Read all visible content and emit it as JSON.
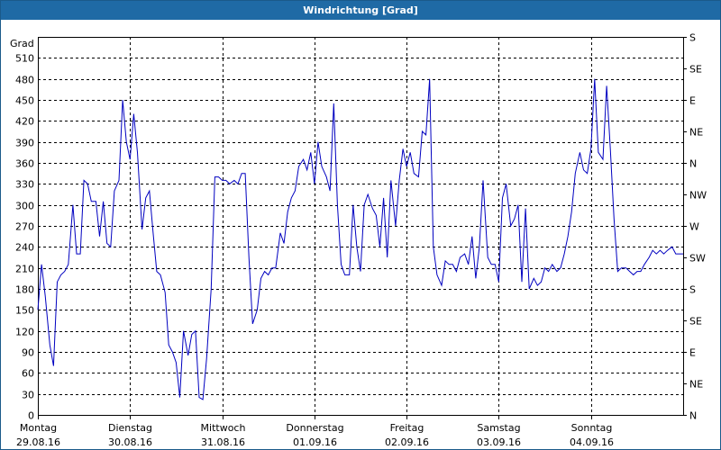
{
  "window": {
    "title": "Windrichtung [Grad]"
  },
  "chart_data": {
    "type": "line",
    "title": "Windrichtung [Grad]",
    "ylabel": "Grad",
    "ylim": [
      0,
      540
    ],
    "xlim": [
      0,
      7
    ],
    "grid": true,
    "y_ticks": [
      0,
      30,
      60,
      90,
      120,
      150,
      180,
      210,
      240,
      270,
      300,
      330,
      360,
      390,
      420,
      450,
      480,
      510
    ],
    "y2_labels": [
      {
        "value": 0,
        "label": "N"
      },
      {
        "value": 45,
        "label": "NE"
      },
      {
        "value": 90,
        "label": "E"
      },
      {
        "value": 135,
        "label": "SE"
      },
      {
        "value": 180,
        "label": "S"
      },
      {
        "value": 225,
        "label": "SW"
      },
      {
        "value": 270,
        "label": "W"
      },
      {
        "value": 315,
        "label": "NW"
      },
      {
        "value": 360,
        "label": "N"
      },
      {
        "value": 405,
        "label": "NE"
      },
      {
        "value": 450,
        "label": "E"
      },
      {
        "value": 495,
        "label": "SE"
      },
      {
        "value": 540,
        "label": "S"
      }
    ],
    "x_ticks": [
      {
        "x": 0,
        "day": "Montag",
        "date": "29.08.16"
      },
      {
        "x": 1,
        "day": "Dienstag",
        "date": "30.08.16"
      },
      {
        "x": 2,
        "day": "Mittwoch",
        "date": "31.08.16"
      },
      {
        "x": 3,
        "day": "Donnerstag",
        "date": "01.09.16"
      },
      {
        "x": 4,
        "day": "Freitag",
        "date": "02.09.16"
      },
      {
        "x": 5,
        "day": "Samstag",
        "date": "03.09.16"
      },
      {
        "x": 6,
        "day": "Sonntag",
        "date": "04.09.16"
      }
    ],
    "series": [
      {
        "color": "#0000c0",
        "points": [
          [
            0.0,
            150
          ],
          [
            0.04,
            215
          ],
          [
            0.08,
            170
          ],
          [
            0.13,
            100
          ],
          [
            0.17,
            70
          ],
          [
            0.21,
            190
          ],
          [
            0.25,
            200
          ],
          [
            0.29,
            205
          ],
          [
            0.33,
            215
          ],
          [
            0.38,
            300
          ],
          [
            0.42,
            230
          ],
          [
            0.46,
            230
          ],
          [
            0.5,
            335
          ],
          [
            0.54,
            330
          ],
          [
            0.58,
            305
          ],
          [
            0.63,
            305
          ],
          [
            0.67,
            255
          ],
          [
            0.71,
            305
          ],
          [
            0.75,
            245
          ],
          [
            0.79,
            240
          ],
          [
            0.83,
            320
          ],
          [
            0.88,
            335
          ],
          [
            0.92,
            450
          ],
          [
            0.96,
            390
          ],
          [
            1.0,
            365
          ],
          [
            1.04,
            430
          ],
          [
            1.08,
            375
          ],
          [
            1.13,
            265
          ],
          [
            1.17,
            310
          ],
          [
            1.21,
            320
          ],
          [
            1.25,
            260
          ],
          [
            1.29,
            205
          ],
          [
            1.33,
            200
          ],
          [
            1.38,
            175
          ],
          [
            1.42,
            100
          ],
          [
            1.46,
            90
          ],
          [
            1.5,
            75
          ],
          [
            1.54,
            25
          ],
          [
            1.58,
            120
          ],
          [
            1.63,
            85
          ],
          [
            1.67,
            115
          ],
          [
            1.71,
            120
          ],
          [
            1.75,
            25
          ],
          [
            1.79,
            22
          ],
          [
            1.83,
            80
          ],
          [
            1.88,
            180
          ],
          [
            1.92,
            340
          ],
          [
            1.96,
            340
          ],
          [
            2.0,
            335
          ],
          [
            2.04,
            335
          ],
          [
            2.08,
            330
          ],
          [
            2.13,
            335
          ],
          [
            2.17,
            330
          ],
          [
            2.21,
            345
          ],
          [
            2.25,
            345
          ],
          [
            2.29,
            225
          ],
          [
            2.33,
            130
          ],
          [
            2.38,
            150
          ],
          [
            2.42,
            195
          ],
          [
            2.46,
            205
          ],
          [
            2.5,
            200
          ],
          [
            2.54,
            210
          ],
          [
            2.58,
            210
          ],
          [
            2.63,
            260
          ],
          [
            2.67,
            245
          ],
          [
            2.71,
            290
          ],
          [
            2.75,
            310
          ],
          [
            2.79,
            320
          ],
          [
            2.83,
            355
          ],
          [
            2.88,
            365
          ],
          [
            2.92,
            350
          ],
          [
            2.96,
            375
          ],
          [
            3.0,
            330
          ],
          [
            3.04,
            390
          ],
          [
            3.08,
            355
          ],
          [
            3.13,
            340
          ],
          [
            3.17,
            320
          ],
          [
            3.21,
            445
          ],
          [
            3.25,
            300
          ],
          [
            3.29,
            215
          ],
          [
            3.33,
            200
          ],
          [
            3.38,
            200
          ],
          [
            3.42,
            300
          ],
          [
            3.46,
            240
          ],
          [
            3.5,
            205
          ],
          [
            3.54,
            300
          ],
          [
            3.58,
            315
          ],
          [
            3.63,
            295
          ],
          [
            3.67,
            285
          ],
          [
            3.71,
            240
          ],
          [
            3.75,
            310
          ],
          [
            3.79,
            225
          ],
          [
            3.83,
            335
          ],
          [
            3.88,
            270
          ],
          [
            3.92,
            335
          ],
          [
            3.96,
            380
          ],
          [
            4.0,
            355
          ],
          [
            4.04,
            375
          ],
          [
            4.08,
            345
          ],
          [
            4.13,
            340
          ],
          [
            4.17,
            405
          ],
          [
            4.21,
            400
          ],
          [
            4.25,
            480
          ],
          [
            4.29,
            240
          ],
          [
            4.33,
            200
          ],
          [
            4.38,
            185
          ],
          [
            4.42,
            220
          ],
          [
            4.46,
            215
          ],
          [
            4.5,
            215
          ],
          [
            4.54,
            205
          ],
          [
            4.58,
            225
          ],
          [
            4.63,
            230
          ],
          [
            4.67,
            215
          ],
          [
            4.71,
            255
          ],
          [
            4.75,
            195
          ],
          [
            4.79,
            240
          ],
          [
            4.83,
            335
          ],
          [
            4.88,
            225
          ],
          [
            4.92,
            215
          ],
          [
            4.96,
            215
          ],
          [
            5.0,
            190
          ],
          [
            5.04,
            310
          ],
          [
            5.08,
            330
          ],
          [
            5.13,
            270
          ],
          [
            5.17,
            280
          ],
          [
            5.21,
            300
          ],
          [
            5.25,
            190
          ],
          [
            5.29,
            295
          ],
          [
            5.33,
            180
          ],
          [
            5.38,
            195
          ],
          [
            5.42,
            185
          ],
          [
            5.46,
            190
          ],
          [
            5.5,
            210
          ],
          [
            5.54,
            205
          ],
          [
            5.58,
            215
          ],
          [
            5.63,
            205
          ],
          [
            5.67,
            210
          ],
          [
            5.71,
            230
          ],
          [
            5.75,
            255
          ],
          [
            5.79,
            290
          ],
          [
            5.83,
            345
          ],
          [
            5.88,
            375
          ],
          [
            5.92,
            350
          ],
          [
            5.96,
            345
          ],
          [
            6.0,
            380
          ],
          [
            6.04,
            480
          ],
          [
            6.08,
            375
          ],
          [
            6.13,
            365
          ],
          [
            6.17,
            470
          ],
          [
            6.21,
            380
          ],
          [
            6.25,
            280
          ],
          [
            6.29,
            205
          ],
          [
            6.33,
            210
          ],
          [
            6.38,
            210
          ],
          [
            6.42,
            205
          ],
          [
            6.46,
            200
          ],
          [
            6.5,
            205
          ],
          [
            6.54,
            205
          ],
          [
            6.58,
            215
          ],
          [
            6.63,
            225
          ],
          [
            6.67,
            235
          ],
          [
            6.71,
            230
          ],
          [
            6.75,
            235
          ],
          [
            6.79,
            230
          ],
          [
            6.83,
            235
          ],
          [
            6.88,
            240
          ],
          [
            6.92,
            230
          ],
          [
            6.96,
            230
          ],
          [
            7.0,
            230
          ]
        ]
      }
    ]
  }
}
